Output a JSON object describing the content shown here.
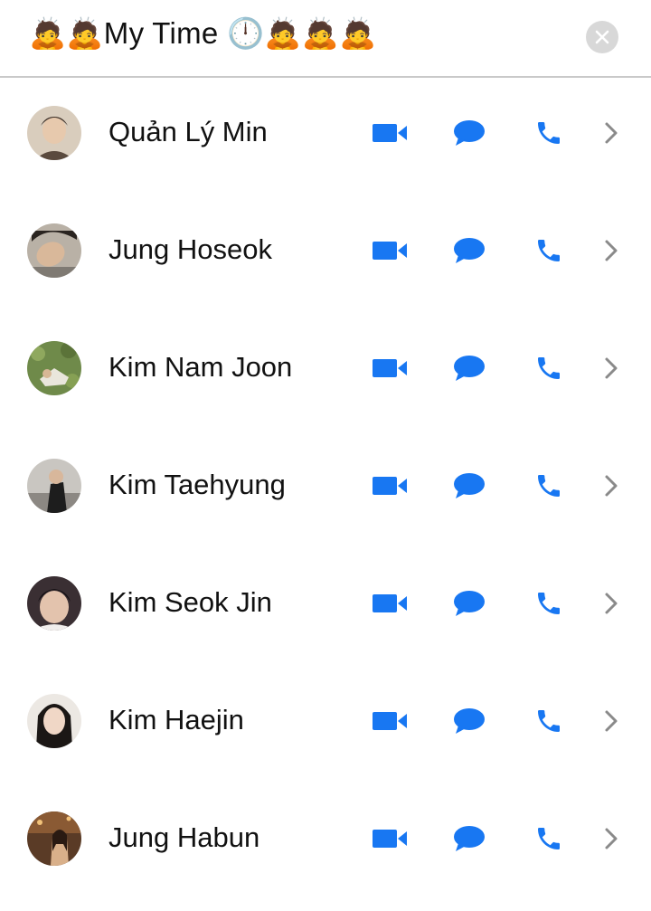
{
  "header": {
    "title": "🙇🙇My Time  🕛🙇🙇🙇"
  },
  "colors": {
    "accent": "#1877f2",
    "chevron": "#8a8a8a",
    "close_bg": "#d8d8d8"
  },
  "contacts": [
    {
      "name": " Quản Lý Min"
    },
    {
      "name": "Jung Hoseok"
    },
    {
      "name": "Kim Nam Joon"
    },
    {
      "name": "Kim Taehyung"
    },
    {
      "name": "Kim Seok Jin"
    },
    {
      "name": "Kim Haejin"
    },
    {
      "name": "Jung Habun"
    }
  ]
}
